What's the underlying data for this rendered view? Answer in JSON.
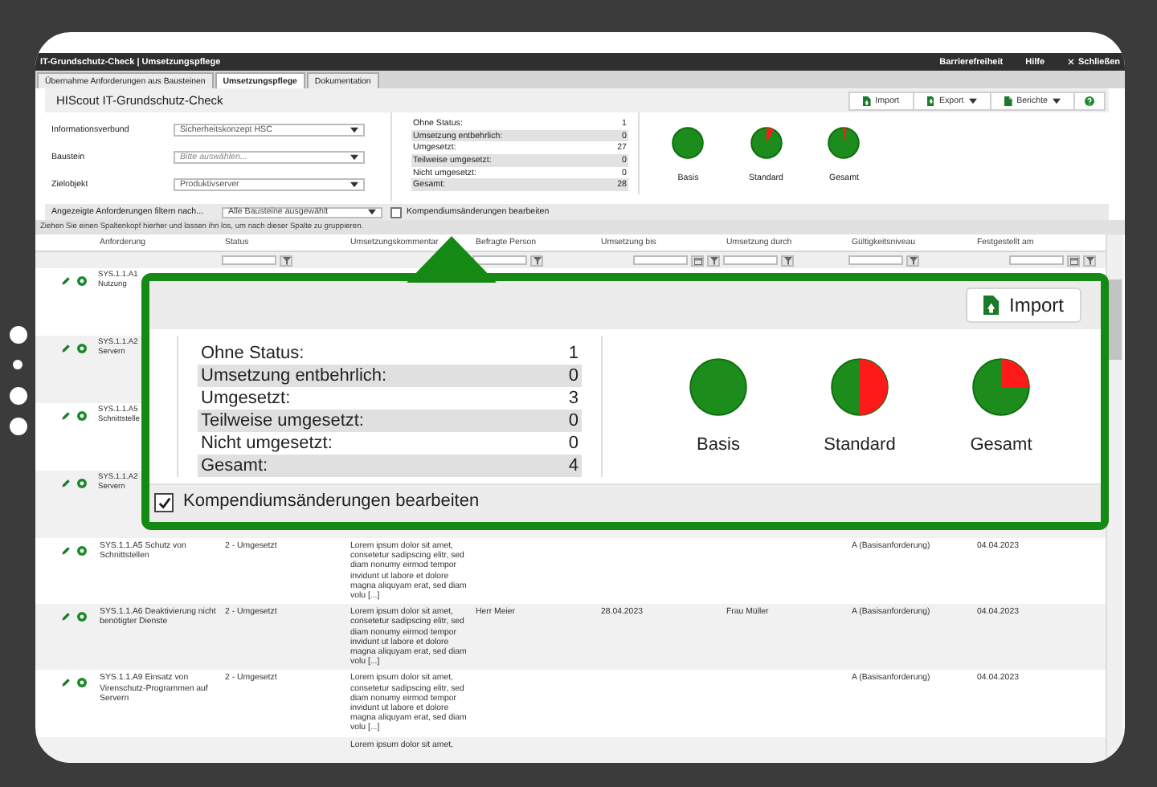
{
  "window": {
    "title": "IT-Grundschutz-Check | Umsetzungspflege",
    "links": [
      {
        "label": "Barrierefreiheit",
        "kind": "link"
      },
      {
        "label": "Hilfe",
        "kind": "link"
      },
      {
        "label": "Schließen",
        "kind": "close"
      }
    ]
  },
  "tabs": [
    {
      "label": "Übernahme Anforderungen aus Bausteinen",
      "selected": false
    },
    {
      "label": "Umsetzungspflege",
      "selected": true
    },
    {
      "label": "Dokumentation",
      "selected": false
    }
  ],
  "page": {
    "title": "HIScout IT-Grundschutz-Check",
    "buttons": [
      {
        "label": "Import",
        "kind": "import",
        "dropdown": false
      },
      {
        "label": "Export",
        "kind": "export",
        "dropdown": true
      },
      {
        "label": "Berichte",
        "kind": "reports",
        "dropdown": true
      },
      {
        "kind": "help",
        "dropdown": false
      }
    ]
  },
  "form": [
    {
      "label": "Informationsverbund",
      "value": "Sicherheitskonzept HSC"
    },
    {
      "label": "Baustein",
      "placeholder": "Bitte auswählen..."
    },
    {
      "label": "Zielobjekt",
      "value": "Produktivserver"
    }
  ],
  "summary": [
    {
      "label": "Ohne Status:",
      "value": "1"
    },
    {
      "label": "Umsetzung entbehrlich:",
      "value": "0"
    },
    {
      "label": "Umgesetzt:",
      "value": "27"
    },
    {
      "label": "Teilweise umgesetzt:",
      "value": "0"
    },
    {
      "label": "Nicht umgesetzt:",
      "value": "0"
    },
    {
      "label": "Gesamt:",
      "value": "28"
    }
  ],
  "levels": [
    {
      "label": "Basis",
      "kind": "full"
    },
    {
      "label": "Standard",
      "kind": "small"
    },
    {
      "label": "Gesamt",
      "kind": "tiny"
    }
  ],
  "filter": {
    "label": "Angezeigte Anforderungen filtern nach...",
    "value": "Alle Bausteine ausgewählt",
    "checkbox": {
      "label": "Kompendiumsänderungen bearbeiten",
      "checked": false
    }
  },
  "group_hint": "Ziehen Sie einen Spaltenkopf hierher und lassen ihn los, um nach dieser Spalte zu gruppieren.",
  "table": {
    "columns": [
      {
        "label": "Anforderung",
        "kind": "plain"
      },
      {
        "label": "Status",
        "kind": "text"
      },
      {
        "label": "Umsetzungskommentar",
        "kind": "plain"
      },
      {
        "label": "Befragte Person",
        "kind": "text"
      },
      {
        "label": "Umsetzung bis",
        "kind": "date"
      },
      {
        "label": "Umsetzung durch",
        "kind": "text"
      },
      {
        "label": "Gültigkeitsniveau",
        "kind": "text"
      },
      {
        "label": "Festgestellt am",
        "kind": "date"
      }
    ],
    "rows": [
      {
        "clipped": true,
        "requirement": "SYS.1.1.A1 Nutzung"
      },
      {
        "clipped": true,
        "requirement": "SYS.1.1.A2 Servern"
      },
      {
        "clipped": true,
        "requirement": "SYS.1.1.A5 Schnittstelle"
      },
      {
        "clipped": true,
        "requirement": "SYS.1.1.A2 Servern"
      },
      {
        "clipped": false,
        "requirement": "SYS.1.1.A5 Schutz von Schnittstellen",
        "status": "2 - Umgesetzt",
        "comment": "Lorem ipsum dolor sit amet, consetetur sadipscing elitr, sed diam nonumy eirmod tempor invidunt ut labore et dolore magna aliquyam erat, sed diam volu [...]",
        "validity": "A (Basisanforderung)",
        "date": "04.04.2023"
      },
      {
        "clipped": false,
        "requirement": "SYS.1.1.A6 Deaktivierung nicht benötigter Dienste",
        "status": "2 - Umgesetzt",
        "comment": "Lorem ipsum dolor sit amet, consetetur sadipscing elitr, sed diam nonumy eirmod tempor invidunt ut labore et dolore magna aliquyam erat, sed diam volu [...]",
        "person": "Herr Meier",
        "due": "28.04.2023",
        "by": "Frau Müller",
        "validity": "A (Basisanforderung)",
        "date": "04.04.2023"
      },
      {
        "clipped": false,
        "requirement": "SYS.1.1.A9 Einsatz von Virenschutz-Programmen auf Servern",
        "status": "2 - Umgesetzt",
        "comment": "Lorem ipsum dolor sit amet, consetetur sadipscing elitr, sed diam nonumy eirmod tempor invidunt ut labore et dolore magna aliquyam erat, sed diam volu [...]",
        "validity": "A (Basisanforderung)",
        "date": "04.04.2023"
      },
      {
        "clipped": false,
        "comment": "Lorem ipsum dolor sit amet,"
      }
    ]
  },
  "callout": {
    "button": {
      "label": "Import",
      "kind": "import"
    },
    "summary": [
      {
        "label": "Ohne Status:",
        "value": "1"
      },
      {
        "label": "Umsetzung entbehrlich:",
        "value": "0"
      },
      {
        "label": "Umgesetzt:",
        "value": "3"
      },
      {
        "label": "Teilweise umgesetzt:",
        "value": "0"
      },
      {
        "label": "Nicht umgesetzt:",
        "value": "0"
      },
      {
        "label": "Gesamt:",
        "value": "4"
      }
    ],
    "levels": [
      {
        "label": "Basis",
        "kind": "full"
      },
      {
        "label": "Standard",
        "kind": "half"
      },
      {
        "label": "Gesamt",
        "kind": "quarter"
      }
    ],
    "checkbox": {
      "label": "Kompendiumsänderungen bearbeiten",
      "checked": true
    }
  }
}
